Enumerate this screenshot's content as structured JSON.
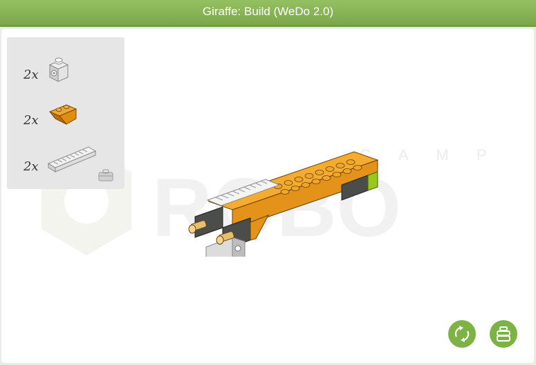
{
  "window": {
    "title": "Giraffe: Build (WeDo 2.0)"
  },
  "watermark": {
    "brand": "ROBO",
    "sub": "CAMP"
  },
  "parts_panel": {
    "parts": [
      {
        "qty": "2x",
        "icon": "technic-brick-1x1-icon"
      },
      {
        "qty": "2x",
        "icon": "inverted-slope-brick-icon"
      },
      {
        "qty": "2x",
        "icon": "gear-rack-icon"
      }
    ],
    "toggle_icon": "toolbox-icon"
  },
  "buttons": {
    "rotate_icon": "rotate-view-icon",
    "parts_icon": "toolbox-icon"
  },
  "colors": {
    "accent": "#7db244",
    "brick_orange": "#e8a020",
    "brick_gray": "#d8d8d8",
    "brick_dark": "#4a4d4a",
    "brick_lime": "#96c81e"
  }
}
